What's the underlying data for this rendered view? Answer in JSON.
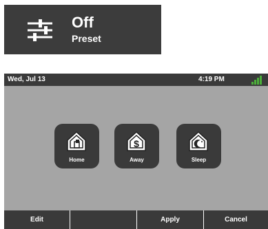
{
  "preset_widget": {
    "value": "Off",
    "label": "Preset",
    "icon": "sliders-icon"
  },
  "status_bar": {
    "date": "Wed, Jul 13",
    "time": "4:19 PM",
    "signal_icon": "signal-strength-icon",
    "signal_color": "#4caf3a"
  },
  "presets": [
    {
      "label": "Home",
      "icon": "home-icon"
    },
    {
      "label": "Away",
      "icon": "away-dollar-icon"
    },
    {
      "label": "Sleep",
      "icon": "sleep-moon-icon"
    }
  ],
  "bottom_bar": {
    "edit": "Edit",
    "blank": "",
    "apply": "Apply",
    "cancel": "Cancel"
  },
  "colors": {
    "panel": "#3a3a3a",
    "screen_bg": "#a5a5a5",
    "accent_green": "#4caf3a"
  }
}
